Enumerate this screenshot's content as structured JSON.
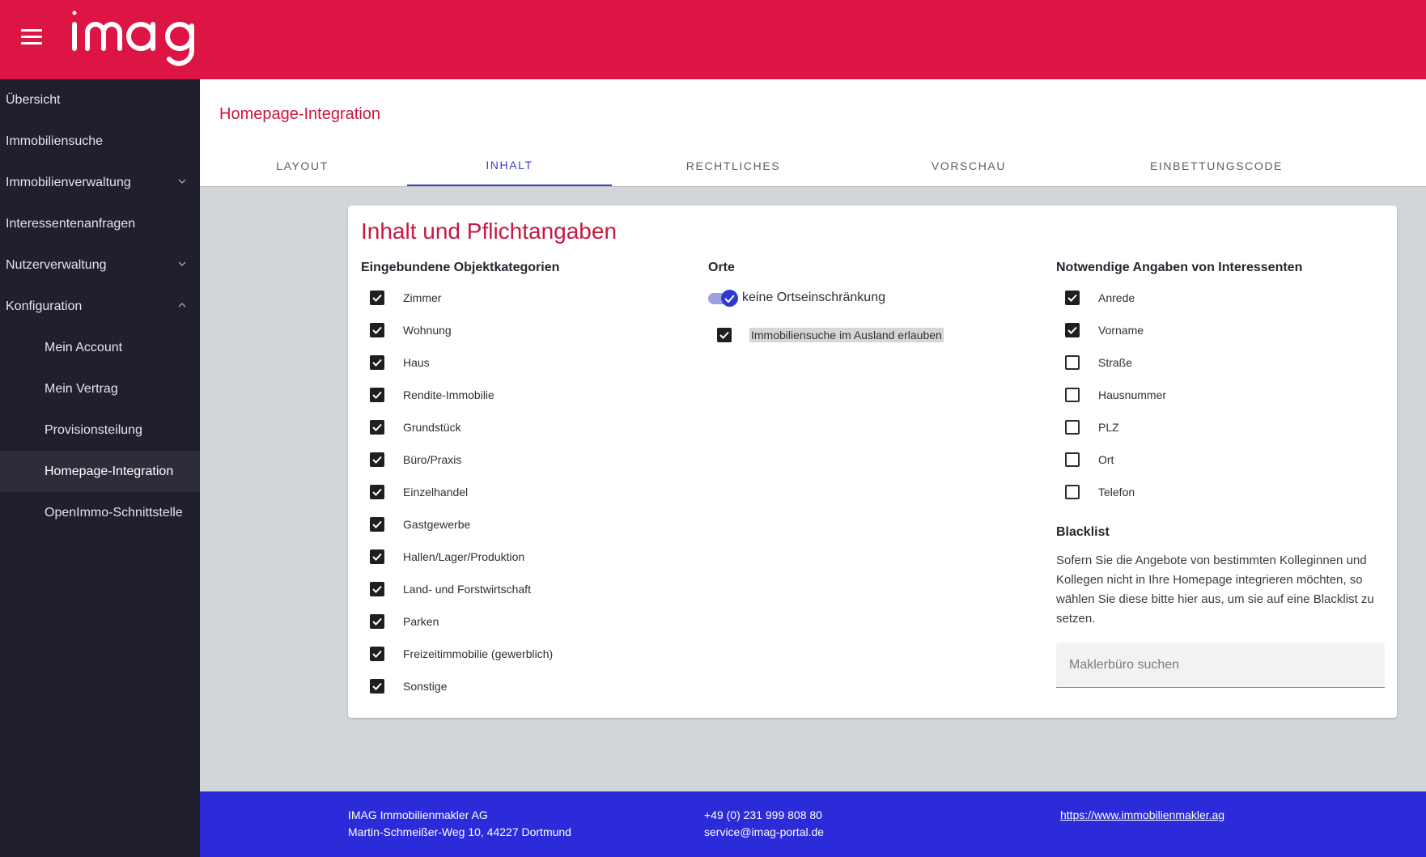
{
  "header": {
    "logo_text": "imag",
    "brand_color": "#dc1544"
  },
  "sidebar": {
    "items": [
      {
        "label": "Übersicht"
      },
      {
        "label": "Immobiliensuche"
      },
      {
        "label": "Immobilienverwaltung",
        "icon": "chevron-down-icon"
      },
      {
        "label": "Interessentenanfragen"
      },
      {
        "label": "Nutzerverwaltung",
        "icon": "chevron-down-icon"
      },
      {
        "label": "Konfiguration",
        "icon": "chevron-up-icon"
      },
      {
        "label": "Mein Account"
      },
      {
        "label": "Mein Vertrag"
      },
      {
        "label": "Provisionsteilung"
      },
      {
        "label": "Homepage-Integration"
      },
      {
        "label": "OpenImmo-Schnittstelle"
      }
    ]
  },
  "page": {
    "title": "Homepage-Integration"
  },
  "tabs": [
    {
      "label": "LAYOUT"
    },
    {
      "label": "INHALT"
    },
    {
      "label": "RECHTLICHES"
    },
    {
      "label": "VORSCHAU"
    },
    {
      "label": "EINBETTUNGSCODE"
    }
  ],
  "card": {
    "title": "Inhalt und Pflichtangaben",
    "categories": {
      "title": "Eingebundene Objektkategorien",
      "items": [
        {
          "label": "Zimmer",
          "checked": true
        },
        {
          "label": "Wohnung",
          "checked": true
        },
        {
          "label": "Haus",
          "checked": true
        },
        {
          "label": "Rendite-Immobilie",
          "checked": true
        },
        {
          "label": "Grundstück",
          "checked": true
        },
        {
          "label": "Büro/Praxis",
          "checked": true
        },
        {
          "label": "Einzelhandel",
          "checked": true
        },
        {
          "label": "Gastgewerbe",
          "checked": true
        },
        {
          "label": "Hallen/Lager/Produktion",
          "checked": true
        },
        {
          "label": "Land- und Forstwirtschaft",
          "checked": true
        },
        {
          "label": "Parken",
          "checked": true
        },
        {
          "label": "Freizeitimmobilie (gewerblich)",
          "checked": true
        },
        {
          "label": "Sonstige",
          "checked": true
        }
      ]
    },
    "orte": {
      "title": "Orte",
      "toggle_label": "keine Ortseinschränkung",
      "toggle_on": true,
      "abroad_label": "Immobiliensuche im Ausland erlauben",
      "abroad_checked": true
    },
    "required": {
      "title": "Notwendige Angaben von Interessenten",
      "items": [
        {
          "label": "Anrede",
          "checked": true
        },
        {
          "label": "Vorname",
          "checked": true
        },
        {
          "label": "Straße",
          "checked": false
        },
        {
          "label": "Hausnummer",
          "checked": false
        },
        {
          "label": "PLZ",
          "checked": false
        },
        {
          "label": "Ort",
          "checked": false
        },
        {
          "label": "Telefon",
          "checked": false
        }
      ]
    },
    "blacklist": {
      "title": "Blacklist",
      "text": "Sofern Sie die Angebote von bestimmten Kolleginnen und Kollegen nicht in Ihre Homepage integrieren möchten, so wählen Sie diese bitte hier aus, um sie auf eine Blacklist zu setzen.",
      "placeholder": "Maklerbüro suchen"
    }
  },
  "footer": {
    "company": "IMAG Immobilienmakler AG",
    "address": "Martin-Schmeißer-Weg 10, 44227 Dortmund",
    "phone": "+49 (0) 231 999 808 80",
    "email": "service@imag-portal.de",
    "website": "https://www.immobilienmakler.ag"
  }
}
